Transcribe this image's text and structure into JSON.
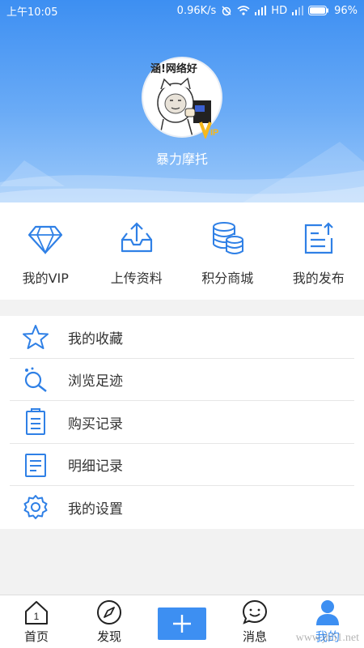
{
  "status_bar": {
    "time": "上午10:05",
    "net_speed": "0.96K/s",
    "signal_hd": "HD",
    "battery": "96%"
  },
  "profile": {
    "avatar_caption": "涵!网络好",
    "vip_badge": "IP",
    "username": "暴力摩托"
  },
  "quick_actions": [
    {
      "label": "我的VIP",
      "icon": "diamond-icon"
    },
    {
      "label": "上传资料",
      "icon": "upload-tray-icon"
    },
    {
      "label": "积分商城",
      "icon": "coins-stack-icon"
    },
    {
      "label": "我的发布",
      "icon": "publish-doc-icon"
    }
  ],
  "menu": [
    {
      "label": "我的收藏",
      "icon": "star-icon"
    },
    {
      "label": "浏览足迹",
      "icon": "magnifier-icon"
    },
    {
      "label": "购买记录",
      "icon": "clipboard-icon"
    },
    {
      "label": "明细记录",
      "icon": "document-icon"
    },
    {
      "label": "我的设置",
      "icon": "gear-icon"
    }
  ],
  "tabs": [
    {
      "label": "首页",
      "icon": "home-icon",
      "badge": "1"
    },
    {
      "label": "发现",
      "icon": "compass-icon"
    },
    {
      "label": "",
      "icon": "plus-icon"
    },
    {
      "label": "消息",
      "icon": "chat-icon"
    },
    {
      "label": "我的",
      "icon": "user-icon"
    }
  ],
  "watermark": "www.jb51.net",
  "colors": {
    "accent": "#3d8ff2",
    "icon_blue": "#2f80e6"
  }
}
